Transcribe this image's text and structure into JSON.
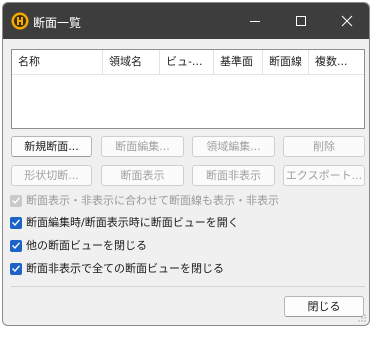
{
  "window": {
    "title": "断面一覧"
  },
  "list": {
    "columns": [
      "名称",
      "領域名",
      "ビュ-...",
      "基準面",
      "断面線",
      "複数..."
    ]
  },
  "buttons": {
    "new_section": "新規断面...",
    "edit_section": "断面編集...",
    "edit_region": "領域編集...",
    "delete": "削除",
    "shape_cut": "形状切断...",
    "show_section": "断面表示",
    "hide_section": "断面非表示",
    "export": "エクスポート...",
    "close": "閉じる"
  },
  "options": [
    {
      "label": "断面表示・非表示に合わせて断面線も表示・非表示",
      "checked": true,
      "enabled": false
    },
    {
      "label": "断面編集時/断面表示時に断面ビューを開く",
      "checked": true,
      "enabled": true
    },
    {
      "label": "他の断面ビューを閉じる",
      "checked": true,
      "enabled": true
    },
    {
      "label": "断面非表示で全ての断面ビューを閉じる",
      "checked": true,
      "enabled": true
    }
  ],
  "colors": {
    "titlebar": "#3d3d3d",
    "accent": "#1b62c9",
    "app_icon": "#f2a900"
  }
}
